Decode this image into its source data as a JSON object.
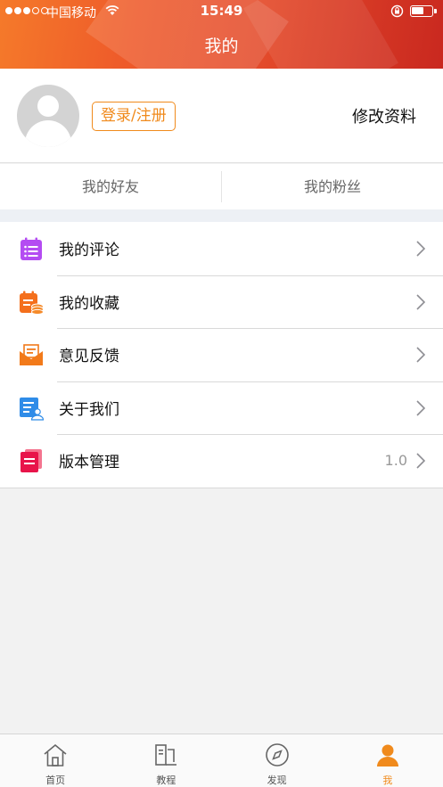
{
  "status_bar": {
    "carrier": "中国移动",
    "time": "15:49",
    "battery_percent": 60
  },
  "header": {
    "title": "我的"
  },
  "profile": {
    "login_label": "登录/注册",
    "edit_label": "修改资料"
  },
  "social": {
    "friends_label": "我的好友",
    "fans_label": "我的粉丝"
  },
  "menu": {
    "items": [
      {
        "label": "我的评论",
        "icon": "comment-list-icon",
        "color": "#b44cf2",
        "value": ""
      },
      {
        "label": "我的收藏",
        "icon": "favorites-coins-icon",
        "color": "#f46f1c",
        "value": ""
      },
      {
        "label": "意见反馈",
        "icon": "feedback-envelope-icon",
        "color": "#f27a1a",
        "value": ""
      },
      {
        "label": "关于我们",
        "icon": "about-document-icon",
        "color": "#2f8ce8",
        "value": ""
      },
      {
        "label": "版本管理",
        "icon": "version-book-icon",
        "color": "#e8144a",
        "value": "1.0"
      }
    ]
  },
  "tabbar": {
    "tabs": [
      {
        "label": "首页",
        "icon": "home-icon",
        "active": false
      },
      {
        "label": "教程",
        "icon": "tutorial-icon",
        "active": false
      },
      {
        "label": "发现",
        "icon": "compass-icon",
        "active": false
      },
      {
        "label": "我",
        "icon": "profile-icon",
        "active": true
      }
    ],
    "active_color": "#f08a1c"
  },
  "colors": {
    "accent": "#f08a1c",
    "header_gradient_start": "#f57a2a",
    "header_gradient_end": "#c9281f"
  }
}
